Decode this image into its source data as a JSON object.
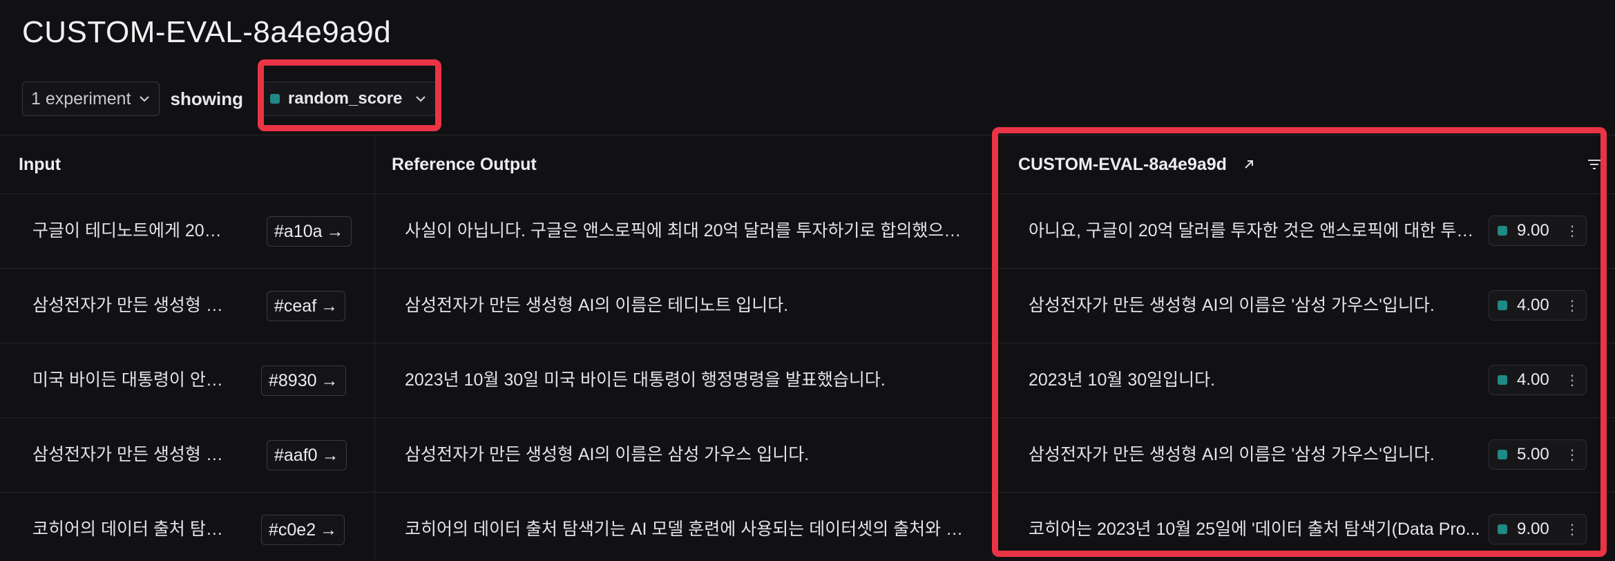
{
  "page": {
    "title": "CUSTOM-EVAL-8a4e9a9d"
  },
  "toolbar": {
    "experiments_label": "1 experiment",
    "showing_label": "showing",
    "metric_label": "random_score",
    "metric_color": "#1f8a86"
  },
  "table": {
    "headers": {
      "input": "Input",
      "reference": "Reference Output",
      "experiment": "CUSTOM-EVAL-8a4e9a9d"
    },
    "rows": [
      {
        "input": "구글이 테디노트에게 20억...",
        "id": "#a10a",
        "reference": "사실이 아닙니다. 구글은 앤스로픽에 최대 20억 달러를 투자하기로 합의했으며, ...",
        "output": "아니요, 구글이 20억 달러를 투자한 것은 앤스로픽에 대한 투자...",
        "score": "9.00"
      },
      {
        "input": "삼성전자가 만든 생성형 AI...",
        "id": "#ceaf",
        "reference": "삼성전자가 만든 생성형 AI의 이름은 테디노트 입니다.",
        "output": "삼성전자가 만든 생성형 AI의 이름은 '삼성 가우스'입니다.",
        "score": "4.00"
      },
      {
        "input": "미국 바이든 대통령이 안전...",
        "id": "#8930",
        "reference": "2023년 10월 30일 미국 바이든 대통령이 행정명령을 발표했습니다.",
        "output": "2023년 10월 30일입니다.",
        "score": "4.00"
      },
      {
        "input": "삼성전자가 만든 생성형 AI...",
        "id": "#aaf0",
        "reference": "삼성전자가 만든 생성형 AI의 이름은 삼성 가우스 입니다.",
        "output": "삼성전자가 만든 생성형 AI의 이름은 '삼성 가우스'입니다.",
        "score": "5.00"
      },
      {
        "input": "코히어의 데이터 출처 탐색...",
        "id": "#c0e2",
        "reference": "코히어의 데이터 출처 탐색기는 AI 모델 훈련에 사용되는 데이터셋의 출처와 라이...",
        "output": "코히어는 2023년 10월 25일에 '데이터 출처 탐색기(Data Pro...",
        "score": "9.00"
      }
    ]
  }
}
